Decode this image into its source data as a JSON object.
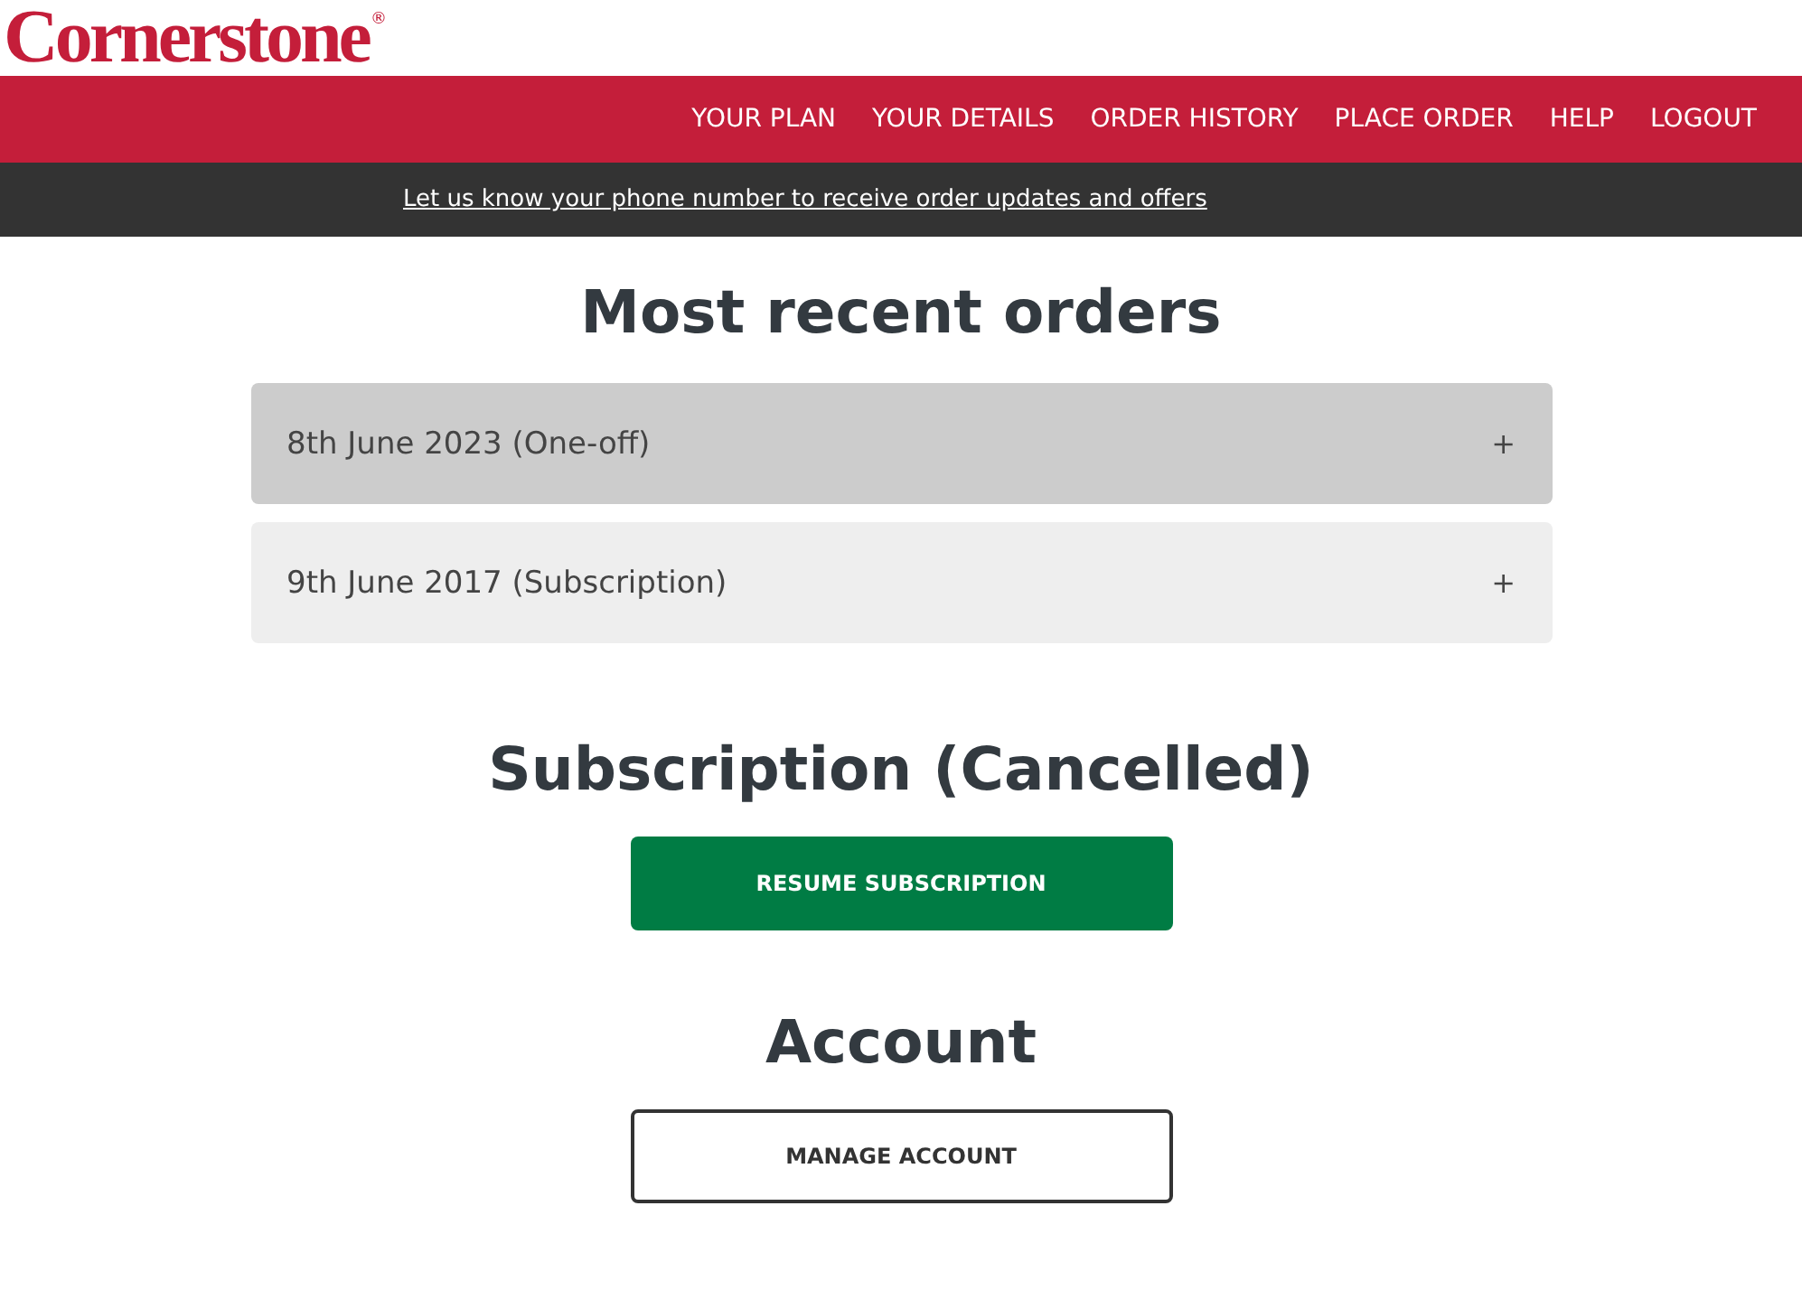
{
  "logo": {
    "name": "Cornerstone",
    "mark": "®"
  },
  "nav": [
    "YOUR PLAN",
    "YOUR DETAILS",
    "ORDER HISTORY",
    "PLACE ORDER",
    "HELP",
    "LOGOUT"
  ],
  "banner": {
    "link": "Let us know your phone number to receive order updates and offers"
  },
  "orders": {
    "heading": "Most recent orders",
    "items": [
      {
        "label": "8th June 2023 (One-off)",
        "toggle": "+",
        "selected": true
      },
      {
        "label": "9th June 2017 (Subscription)",
        "toggle": "+",
        "selected": false
      }
    ]
  },
  "subscription": {
    "heading": "Subscription (Cancelled)",
    "button": "RESUME SUBSCRIPTION"
  },
  "account": {
    "heading": "Account",
    "button": "MANAGE ACCOUNT"
  }
}
